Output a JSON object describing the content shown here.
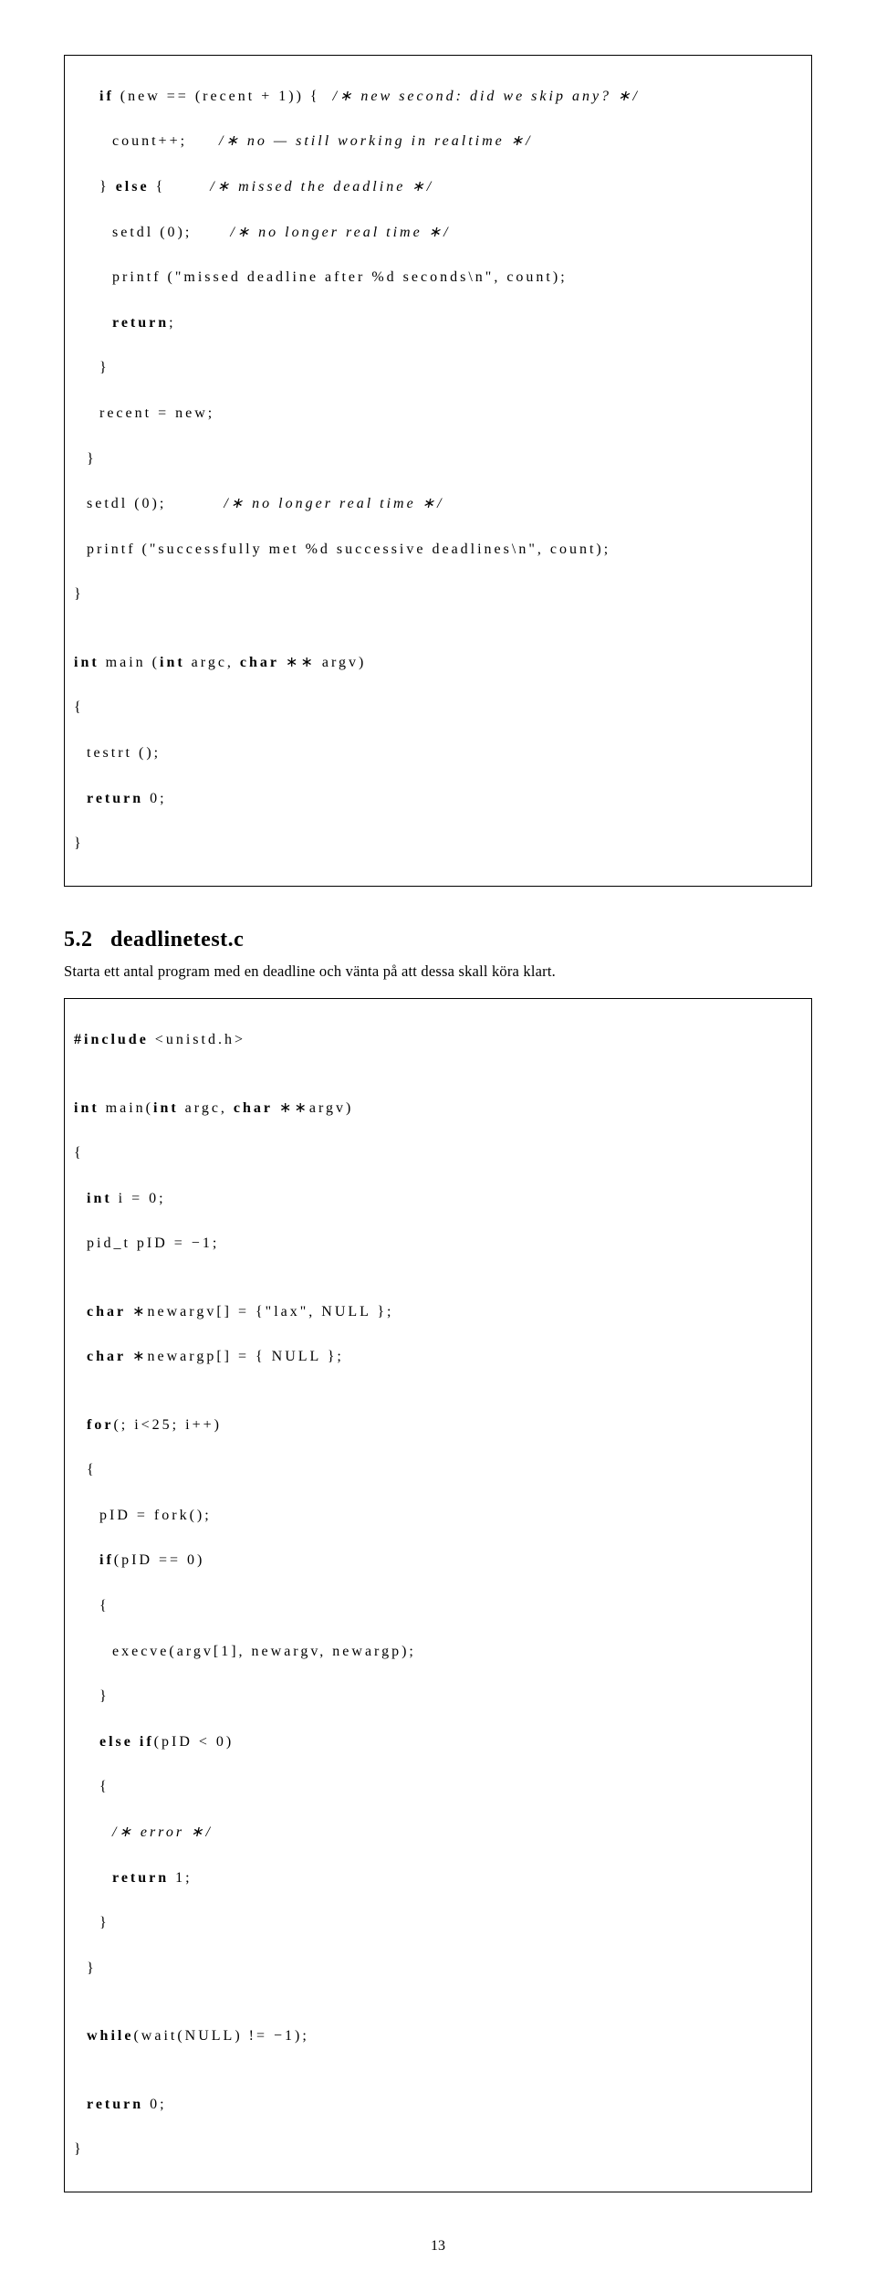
{
  "code1": {
    "l1": {
      "t": "    if (new == (recent + 1)) {  /∗ new second: did we skip any? ∗/"
    },
    "l2": {
      "t": "      count++;     /∗ no — still working in realtime ∗/"
    },
    "l3": {
      "t": "    } else {       /∗ missed the deadline ∗/"
    },
    "l4": {
      "t": "      setdl (0);      /∗ no longer real time ∗/"
    },
    "l5": {
      "t": "      printf (\"missed deadline after %d seconds\\n\", count);"
    },
    "l6": {
      "t": "      return;"
    },
    "l7": {
      "t": "    }"
    },
    "l8": {
      "t": "    recent = new;"
    },
    "l9": {
      "t": "  }"
    },
    "l10": {
      "t": "  setdl (0);         /∗ no longer real time ∗/"
    },
    "l11": {
      "t": "  printf (\"successfully met %d successive deadlines\\n\", count);"
    },
    "l12": {
      "t": "}"
    },
    "l13": {
      "t": ""
    },
    "l14": {
      "t": "int main (int argc, char ∗∗ argv)"
    },
    "l15": {
      "t": "{"
    },
    "l16": {
      "t": "  testrt ();"
    },
    "l17": {
      "t": "  return 0;"
    },
    "l18": {
      "t": "}"
    }
  },
  "section": {
    "num": "5.2",
    "title": "deadlinetest.c"
  },
  "paragraph": "Starta ett antal program med en deadline och vänta på att dessa skall köra klart.",
  "code2": {
    "l1": {
      "t": "#include <unistd.h>"
    },
    "l2": {
      "t": ""
    },
    "l3": {
      "t": "int main(int argc, char ∗∗argv)"
    },
    "l4": {
      "t": "{"
    },
    "l5": {
      "t": "  int i = 0;"
    },
    "l6": {
      "t": "  pid_t pID = −1;"
    },
    "l7": {
      "t": ""
    },
    "l8": {
      "t": "  char ∗newargv[] = {\"lax\", NULL };"
    },
    "l9": {
      "t": "  char ∗newargp[] = { NULL };"
    },
    "l10": {
      "t": ""
    },
    "l11": {
      "t": "  for(; i<25; i++)"
    },
    "l12": {
      "t": "  {"
    },
    "l13": {
      "t": "    pID = fork();"
    },
    "l14": {
      "t": "    if(pID == 0)"
    },
    "l15": {
      "t": "    {"
    },
    "l16": {
      "t": "      execve(argv[1], newargv, newargp);"
    },
    "l17": {
      "t": "    }"
    },
    "l18": {
      "t": "    else if(pID < 0)"
    },
    "l19": {
      "t": "    {"
    },
    "l20": {
      "t": "      /∗ error ∗/"
    },
    "l21": {
      "t": "      return 1;"
    },
    "l22": {
      "t": "    }"
    },
    "l23": {
      "t": "  }"
    },
    "l24": {
      "t": ""
    },
    "l25": {
      "t": "  while(wait(NULL) != −1);"
    },
    "l26": {
      "t": ""
    },
    "l27": {
      "t": "  return 0;"
    },
    "l28": {
      "t": "}"
    }
  },
  "pagenum": "13"
}
